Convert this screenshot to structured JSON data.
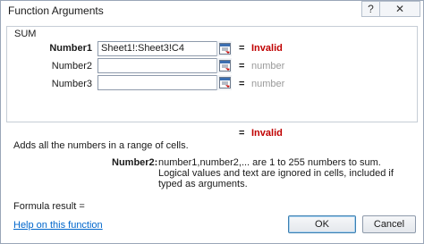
{
  "window": {
    "title": "Function Arguments",
    "help_label": "?",
    "close_label": "✕"
  },
  "function": {
    "name": "SUM",
    "args": [
      {
        "label": "Number1",
        "value": "Sheet1!:Sheet3!C4",
        "equals": "=",
        "result": "Invalid"
      },
      {
        "label": "Number2",
        "value": "",
        "equals": "=",
        "result": "number"
      },
      {
        "label": "Number3",
        "value": "",
        "equals": "=",
        "result": "number"
      }
    ],
    "total_equals": "=",
    "total_result": "Invalid",
    "description": "Adds all the numbers in a range of cells.",
    "arg_help_name": "Number2:",
    "arg_help_text": "number1,number2,... are 1 to 255 numbers to sum. Logical values and text are ignored in cells, included if typed as arguments."
  },
  "footer": {
    "formula_result": "Formula result =",
    "help_link": "Help on this function",
    "ok_label": "OK",
    "cancel_label": "Cancel"
  },
  "colors": {
    "invalid": "#c00000",
    "hint": "#9a9a9a",
    "link": "#0066cc"
  },
  "icons": {
    "ref_button": "collapse-dialog-icon"
  }
}
